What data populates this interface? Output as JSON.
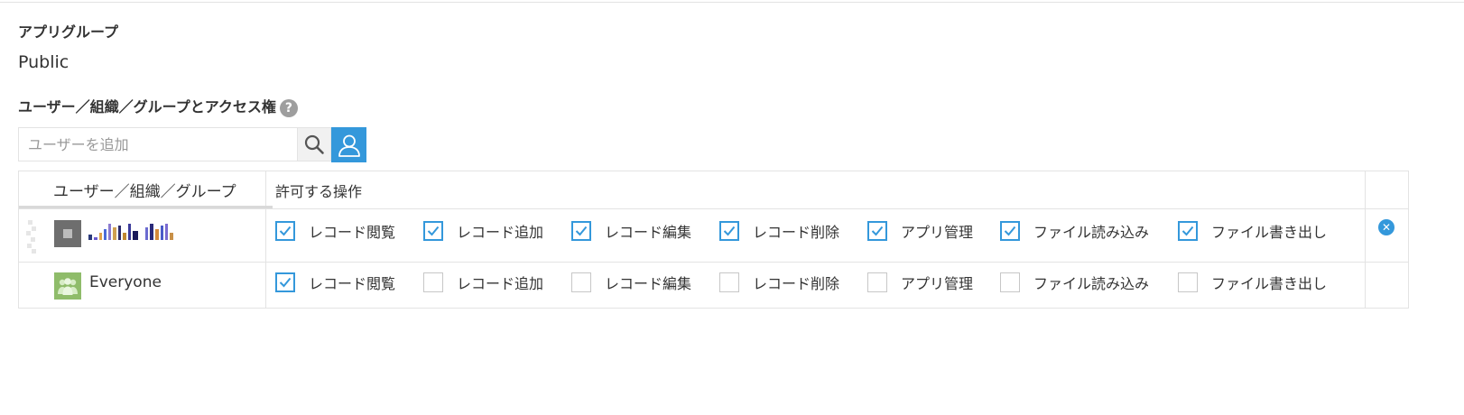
{
  "app_group": {
    "label": "アプリグループ",
    "value": "Public"
  },
  "access": {
    "label": "ユーザー／組織／グループとアクセス権",
    "help_icon": "question-circle-icon"
  },
  "search": {
    "placeholder": "ユーザーを追加",
    "search_icon": "search-icon",
    "user_select_icon": "user-icon"
  },
  "table": {
    "headers": {
      "entity": "ユーザー／組織／グループ",
      "permissions": "許可する操作"
    },
    "rows": [
      {
        "entity_name": "",
        "entity_type": "user",
        "avatar_icon": "user-avatar-icon",
        "removable": true,
        "remove_icon": "remove-circle-icon",
        "permissions": [
          {
            "label": "レコード閲覧",
            "checked": true
          },
          {
            "label": "レコード追加",
            "checked": true
          },
          {
            "label": "レコード編集",
            "checked": true
          },
          {
            "label": "レコード削除",
            "checked": true
          },
          {
            "label": "アプリ管理",
            "checked": true
          },
          {
            "label": "ファイル読み込み",
            "checked": true
          },
          {
            "label": "ファイル書き出し",
            "checked": true
          }
        ]
      },
      {
        "entity_name": "Everyone",
        "entity_type": "group",
        "avatar_icon": "everyone-group-icon",
        "removable": false,
        "permissions": [
          {
            "label": "レコード閲覧",
            "checked": true
          },
          {
            "label": "レコード追加",
            "checked": false
          },
          {
            "label": "レコード編集",
            "checked": false
          },
          {
            "label": "レコード削除",
            "checked": false
          },
          {
            "label": "アプリ管理",
            "checked": false
          },
          {
            "label": "ファイル読み込み",
            "checked": false
          },
          {
            "label": "ファイル書き出し",
            "checked": false
          }
        ]
      }
    ]
  },
  "colors": {
    "accent": "#3498db",
    "border": "#e3e3e3",
    "everyone_avatar": "#8fbc6a",
    "text": "#333333"
  }
}
